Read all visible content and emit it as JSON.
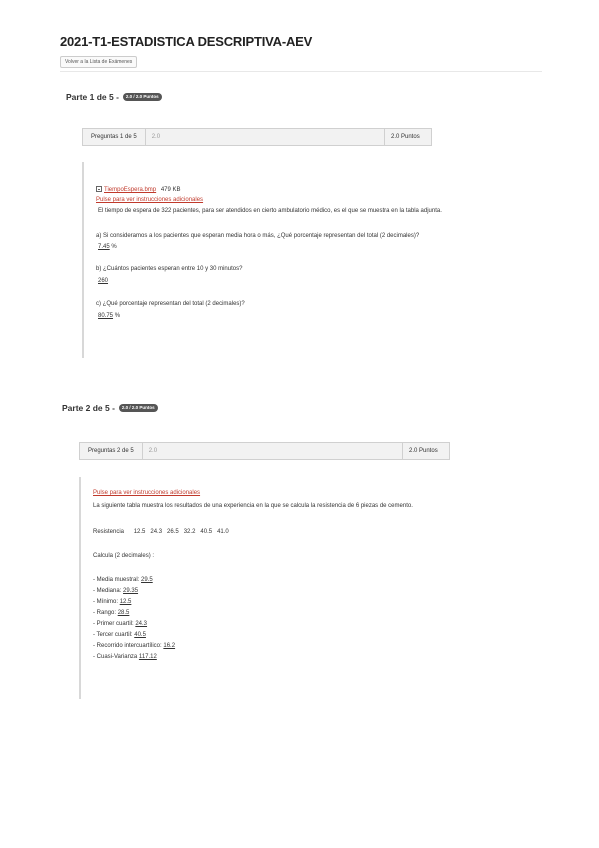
{
  "header": {
    "title": "2021-T1-ESTADISTICA DESCRIPTIVA-AEV",
    "back_button": "Volver a la Lista de Exámenes"
  },
  "part1": {
    "title": "Parte 1 de 5 -",
    "badge": "2.0 / 2.0 Puntos",
    "question_label": "Preguntas 1 de 5",
    "score": "2.0",
    "points": "2.0 Puntos",
    "attachment": {
      "name": "TiempoEspera.bmp",
      "size": "479 KB",
      "icon": "file-image-icon"
    },
    "instructions_link": "Pulse para ver instrucciones adicionales",
    "intro": "El tiempo de espera de 322 pacientes, para ser atendidos en cierto ambulatorio médico, es el que se muestra en la tabla adjunta.",
    "qa": {
      "q": "a) Si consideramos a los pacientes que esperan media hora o más, ¿Qué porcentaje representan del total (2 decimales)?",
      "a": "7.45",
      "unit": "%"
    },
    "qb": {
      "q": "b) ¿Cuántos pacientes esperan entre 10 y 30 minutos?",
      "a": "260"
    },
    "qc": {
      "q": "c) ¿Qué porcentaje representan del total (2 decimales)?",
      "a": "80.75",
      "unit": "%"
    }
  },
  "part2": {
    "title": "Parte 2 de 5 -",
    "badge": "2.0 / 2.0 Puntos",
    "question_label": "Preguntas 2 de 5",
    "score": "2.0",
    "points": "2.0 Puntos",
    "instructions_link": "Pulse para ver instrucciones adicionales",
    "intro": "La siguiente tabla muestra los resultados de una experiencia en la que se calcula la resistencia de 6 piezas de cemento.",
    "resistencia_label": "Resistencia",
    "resistencia_values": "12.5   24.3   26.5   32.2   40.5   41.0",
    "calcula": "Calcula (2 decimales) :",
    "items": [
      {
        "label": "- Media muestral:",
        "value": "29.5"
      },
      {
        "label": "- Mediana:",
        "value": "29.35"
      },
      {
        "label": "- Mínimo:",
        "value": "12.5"
      },
      {
        "label": "- Rango:",
        "value": "28.5"
      },
      {
        "label": "- Primer cuartil:",
        "value": "24.3"
      },
      {
        "label": "- Tercer cuartil:",
        "value": "40.5"
      },
      {
        "label": "- Recorrido intercuartílico:",
        "value": "16.2"
      },
      {
        "label": "- Cuasi-Varianza",
        "value": "117.12"
      }
    ]
  }
}
